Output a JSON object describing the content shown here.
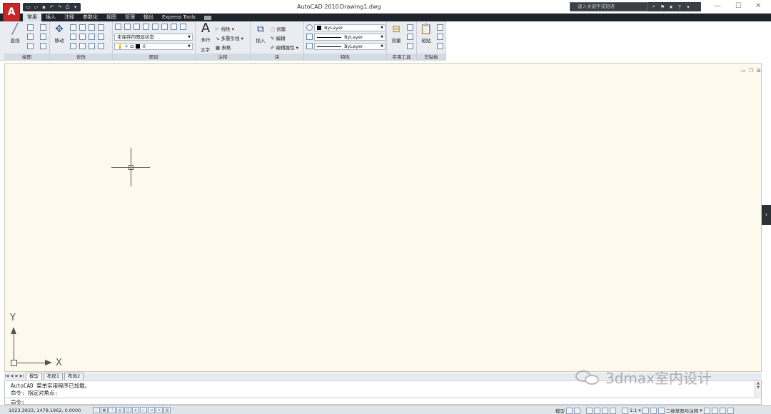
{
  "window": {
    "app_title": "AutoCAD 2010",
    "file_name": "Drawing1.dwg",
    "search_placeholder": "键入关键字或短语"
  },
  "app_button": {
    "glyph": "A"
  },
  "ribbon_tabs": [
    {
      "label": "常用",
      "active": true
    },
    {
      "label": "插入"
    },
    {
      "label": "注释"
    },
    {
      "label": "参数化"
    },
    {
      "label": "视图"
    },
    {
      "label": "管理"
    },
    {
      "label": "输出"
    },
    {
      "label": "Express Tools"
    }
  ],
  "panels": {
    "draw": {
      "title": "绘图",
      "line_label": "直线"
    },
    "modify": {
      "title": "修改",
      "move_label": "移动"
    },
    "layers": {
      "title": "图层",
      "layer_state": "未保存的图层状态",
      "current_layer": "0"
    },
    "annotation": {
      "title": "注释",
      "mtext_label_1": "多行",
      "mtext_label_2": "文字",
      "linear_label": "线性",
      "mleader_label": "多重引线",
      "table_label": "表格"
    },
    "block": {
      "title": "块",
      "insert_label": "插入",
      "create_label": "创建",
      "edit_label": "编辑",
      "edit_attr_label": "编辑属性"
    },
    "properties": {
      "title": "特性",
      "color": "ByLayer",
      "linetype": "ByLayer",
      "lineweight": "ByLayer"
    },
    "utilities": {
      "title": "实用工具",
      "measure_label": "测量"
    },
    "clipboard": {
      "title": "剪贴板",
      "paste_label": "粘贴"
    }
  },
  "ucs": {
    "y_label": "Y",
    "x_label": "X"
  },
  "layout_tabs": [
    {
      "label": "模型",
      "active": true
    },
    {
      "label": "布局1"
    },
    {
      "label": "布局2"
    }
  ],
  "command": {
    "history": [
      "AutoCAD 菜单实用程序已加载。",
      "命令: 指定对角点:"
    ],
    "prompt": "命令:"
  },
  "status": {
    "coordinates": "1023.3833, 1478.1962, 0.0000",
    "model_label": "模型",
    "scale_label": "1:1",
    "workspace_label": "二维草图与注释"
  },
  "watermark": {
    "text": "3dmax室内设计"
  }
}
